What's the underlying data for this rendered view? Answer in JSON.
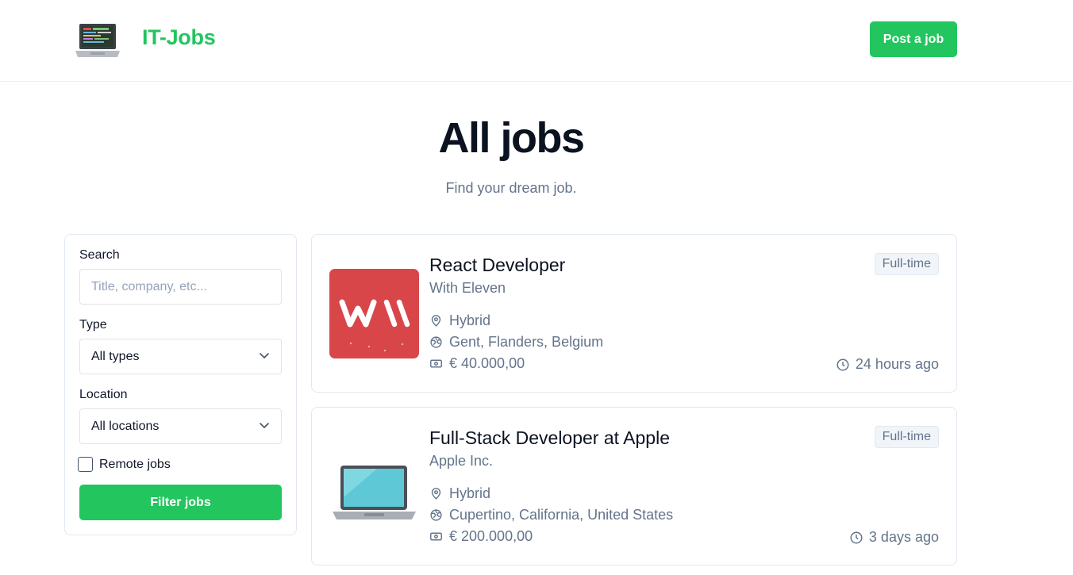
{
  "header": {
    "brand": "IT-Jobs",
    "post_job_label": "Post a job",
    "logo_icon": "laptop-logo-icon"
  },
  "hero": {
    "title": "All jobs",
    "subtitle": "Find your dream job."
  },
  "filters": {
    "search_label": "Search",
    "search_placeholder": "Title, company, etc...",
    "search_value": "",
    "type_label": "Type",
    "type_selected": "All types",
    "location_label": "Location",
    "location_selected": "All locations",
    "remote_label": "Remote jobs",
    "remote_checked": false,
    "submit_label": "Filter jobs"
  },
  "jobs": [
    {
      "title": "React Developer",
      "company": "With Eleven",
      "type": "Full-time",
      "location_type": "Hybrid",
      "location": "Gent, Flanders, Belgium",
      "salary": "€ 40.000,00",
      "posted": "24 hours ago",
      "logo": "with-eleven-logo"
    },
    {
      "title": "Full-Stack Developer at Apple",
      "company": "Apple Inc.",
      "type": "Full-time",
      "location_type": "Hybrid",
      "location": "Cupertino, California, United States",
      "salary": "€ 200.000,00",
      "posted": "3 days ago",
      "logo": "laptop-logo"
    }
  ],
  "colors": {
    "accent": "#22c55e",
    "muted_text": "#64748b",
    "border": "#e2e8f0",
    "with_eleven_red": "#d9464a"
  }
}
